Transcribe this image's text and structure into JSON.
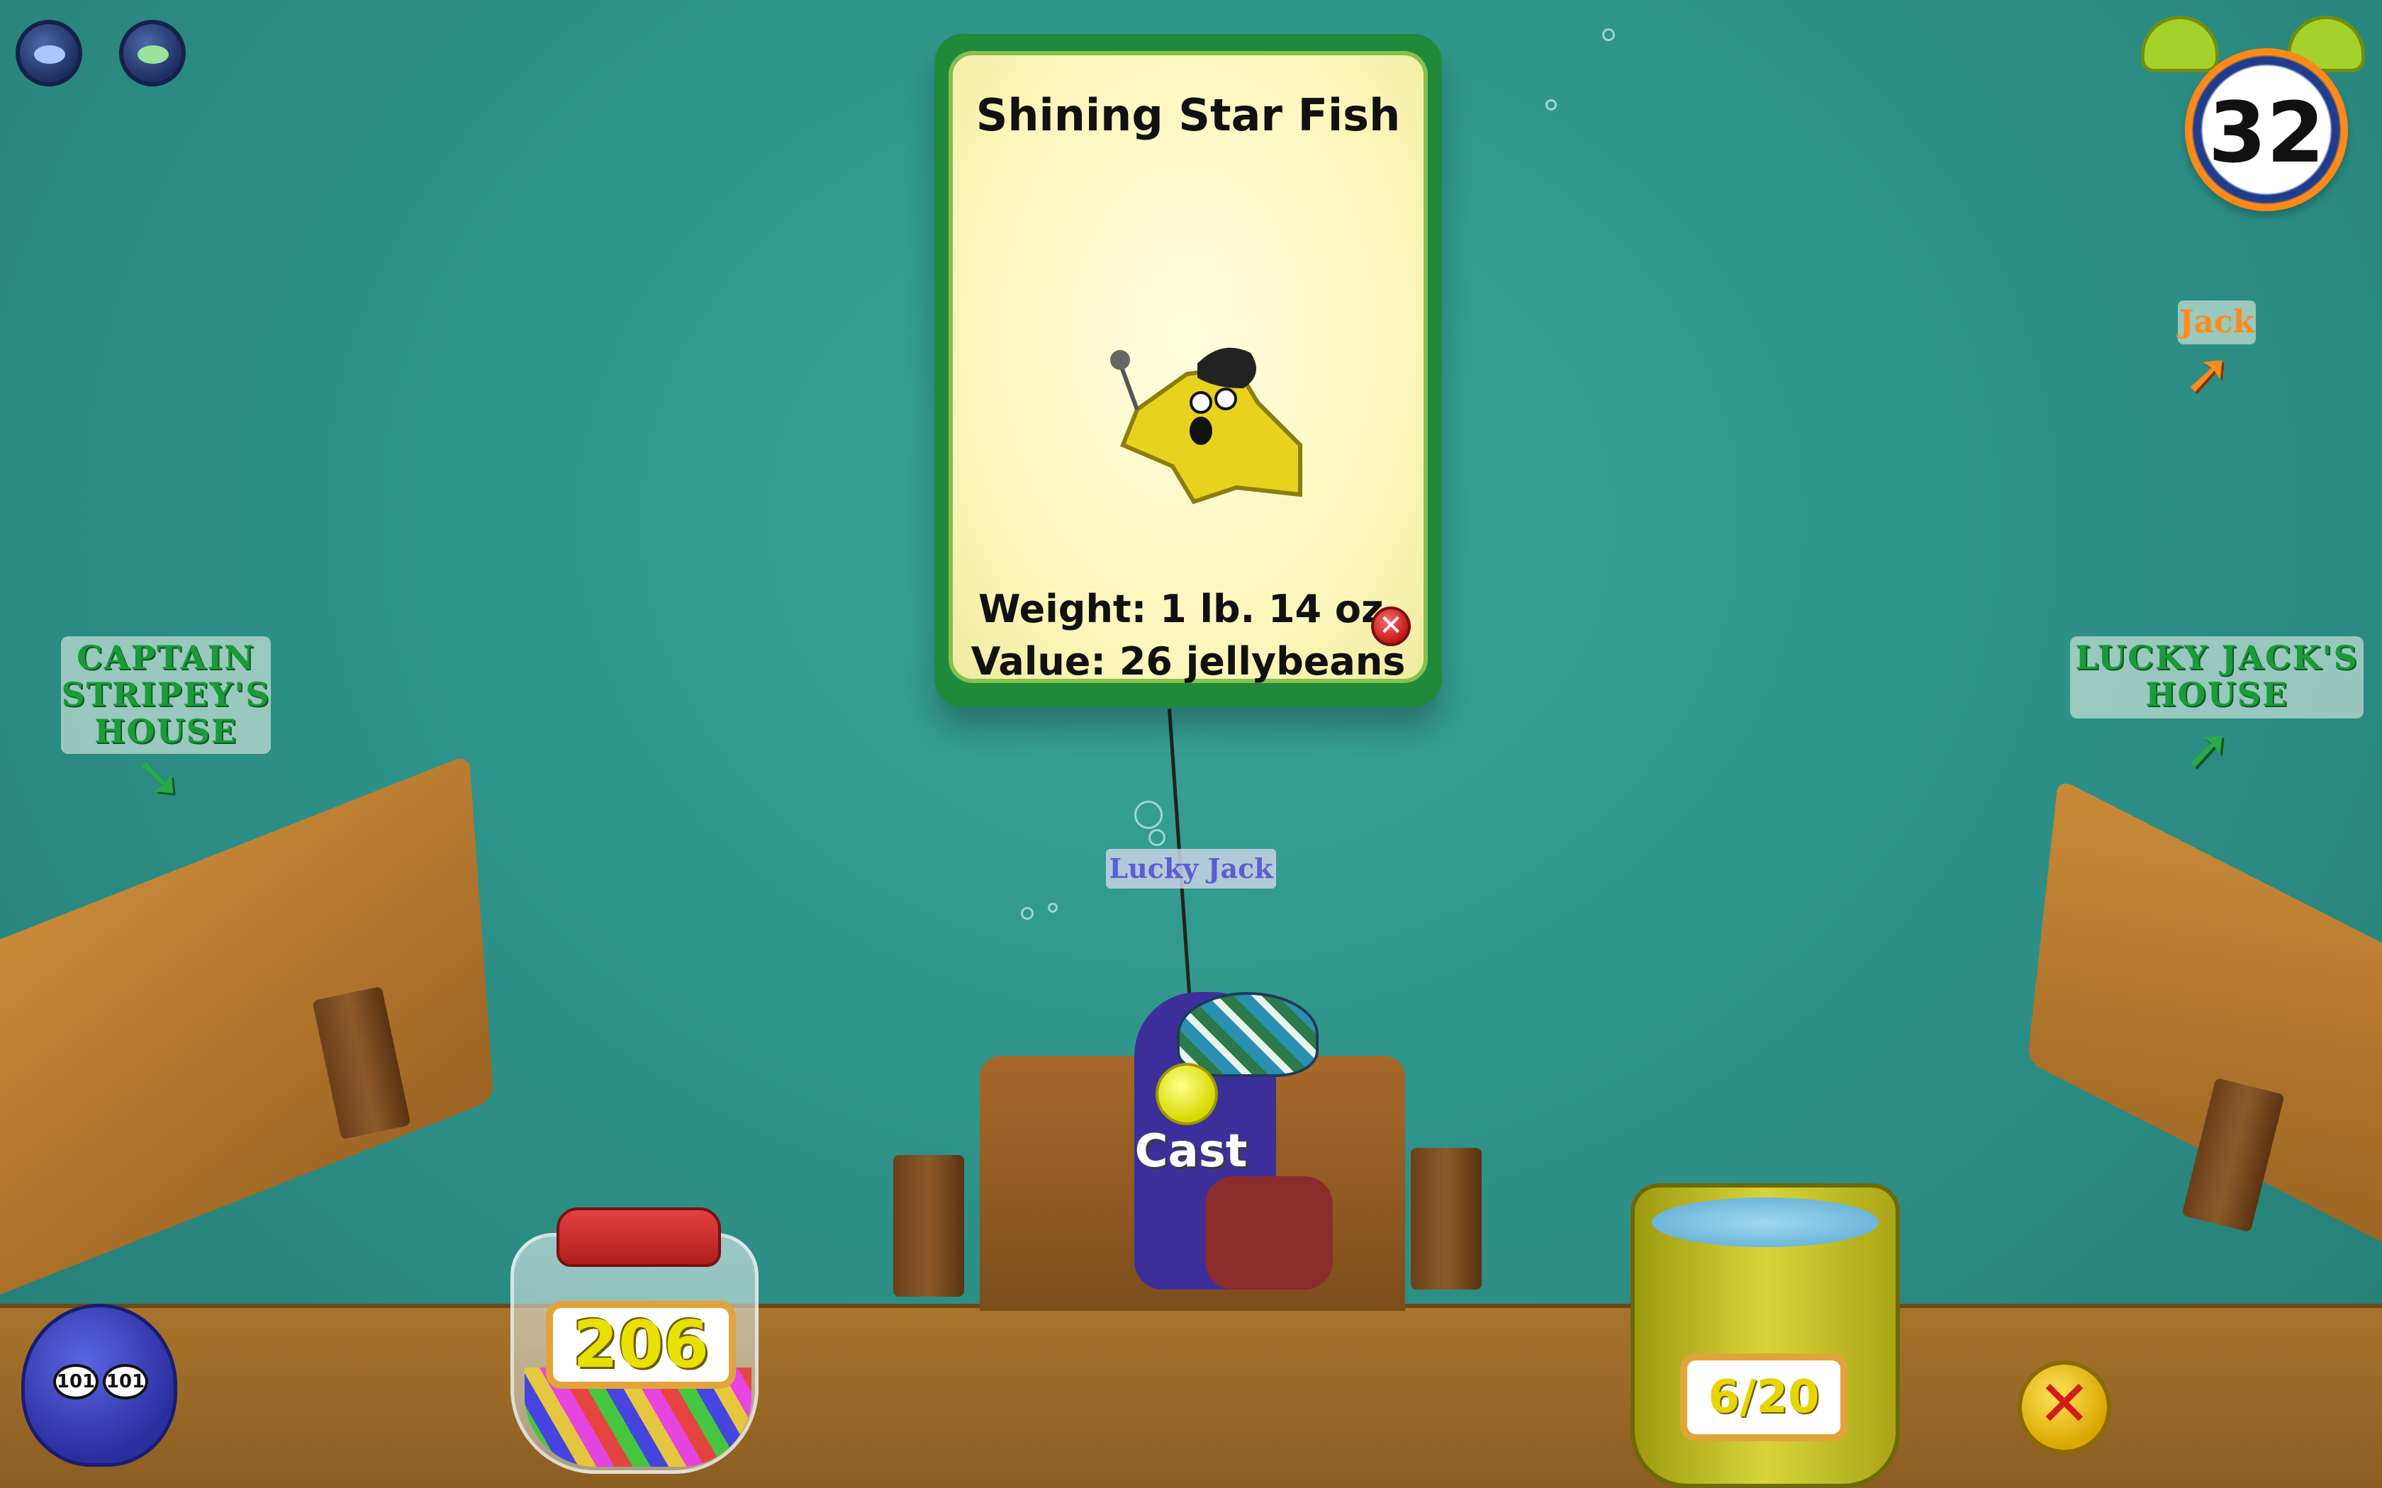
{
  "fish_card": {
    "title": "Shining Star Fish",
    "weight": "Weight: 1 lb. 14 oz.",
    "value": "Value: 26 jellybeans",
    "close_glyph": "✕"
  },
  "timer": {
    "value": "32"
  },
  "signs": {
    "captain_stripey": "CAPTAIN STRIPEY'S HOUSE",
    "lucky_jack_house": "LUCKY JACK'S HOUSE",
    "jack": "Jack"
  },
  "player": {
    "name": "Lucky Jack",
    "action": "Cast"
  },
  "jellybeans": {
    "count": "206"
  },
  "bucket": {
    "count": "6/20"
  },
  "laff_meter": {
    "current": "101",
    "max": "101"
  },
  "exit_button": {
    "glyph": "✕"
  },
  "icons": [
    "chat-speedchat-icon",
    "chat-speedchat-plus-icon",
    "alarm-clock-icon",
    "arrow-icon",
    "close-icon",
    "laff-meter-icon",
    "jellybean-jar-icon",
    "fish-bucket-icon"
  ],
  "colors": {
    "card_border": "#1f8a3a",
    "card_bg": "#fbf6b8",
    "sign_text": "#1b9a3a",
    "jack_text": "#ff8c1a",
    "timer_ring": "#ff8c1a"
  }
}
